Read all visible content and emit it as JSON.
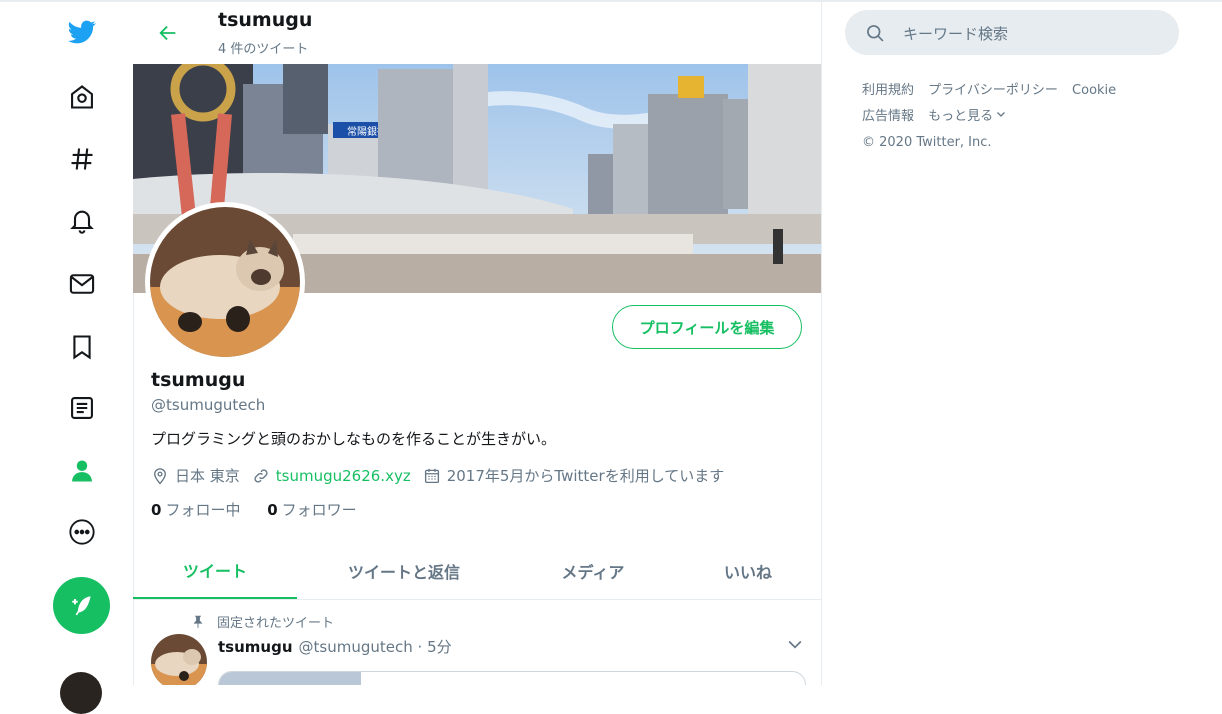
{
  "header": {
    "name": "tsumugu",
    "tweet_count": "4 件のツイート"
  },
  "profile": {
    "name": "tsumugu",
    "handle": "@tsumugutech",
    "bio": "プログラミングと頭のおかしなものを作ることが生きがい。",
    "location": "日本 東京",
    "website": "tsumugu2626.xyz",
    "joined": "2017年5月からTwitterを利用しています",
    "following_count": "0",
    "following_label": "フォロー中",
    "followers_count": "0",
    "followers_label": "フォロワー",
    "edit_label": "プロフィールを編集"
  },
  "banner": {
    "sign_text": "常陽銀行"
  },
  "tabs": [
    {
      "label": "ツイート",
      "active": true
    },
    {
      "label": "ツイートと返信",
      "active": false
    },
    {
      "label": "メディア",
      "active": false
    },
    {
      "label": "いいね",
      "active": false
    }
  ],
  "tweet": {
    "pinned_label": "固定されたツイート",
    "author": "tsumugu",
    "handle": "@tsumugutech",
    "separator": "·",
    "time": "5分"
  },
  "search": {
    "placeholder": "キーワード検索"
  },
  "footer": {
    "terms": "利用規約",
    "privacy": "プライバシーポリシー",
    "cookie": "Cookie",
    "ads": "広告情報",
    "more": "もっと見る",
    "copyright": "© 2020 Twitter, Inc."
  },
  "nav": {
    "items": [
      "twitter-logo",
      "home",
      "explore",
      "notifications",
      "messages",
      "bookmarks",
      "lists",
      "profile",
      "more"
    ],
    "active": "profile"
  },
  "colors": {
    "accent": "#17bf63",
    "twitter_blue": "#1da1f2",
    "secondary_text": "#657786",
    "border": "#e6ecf0"
  }
}
